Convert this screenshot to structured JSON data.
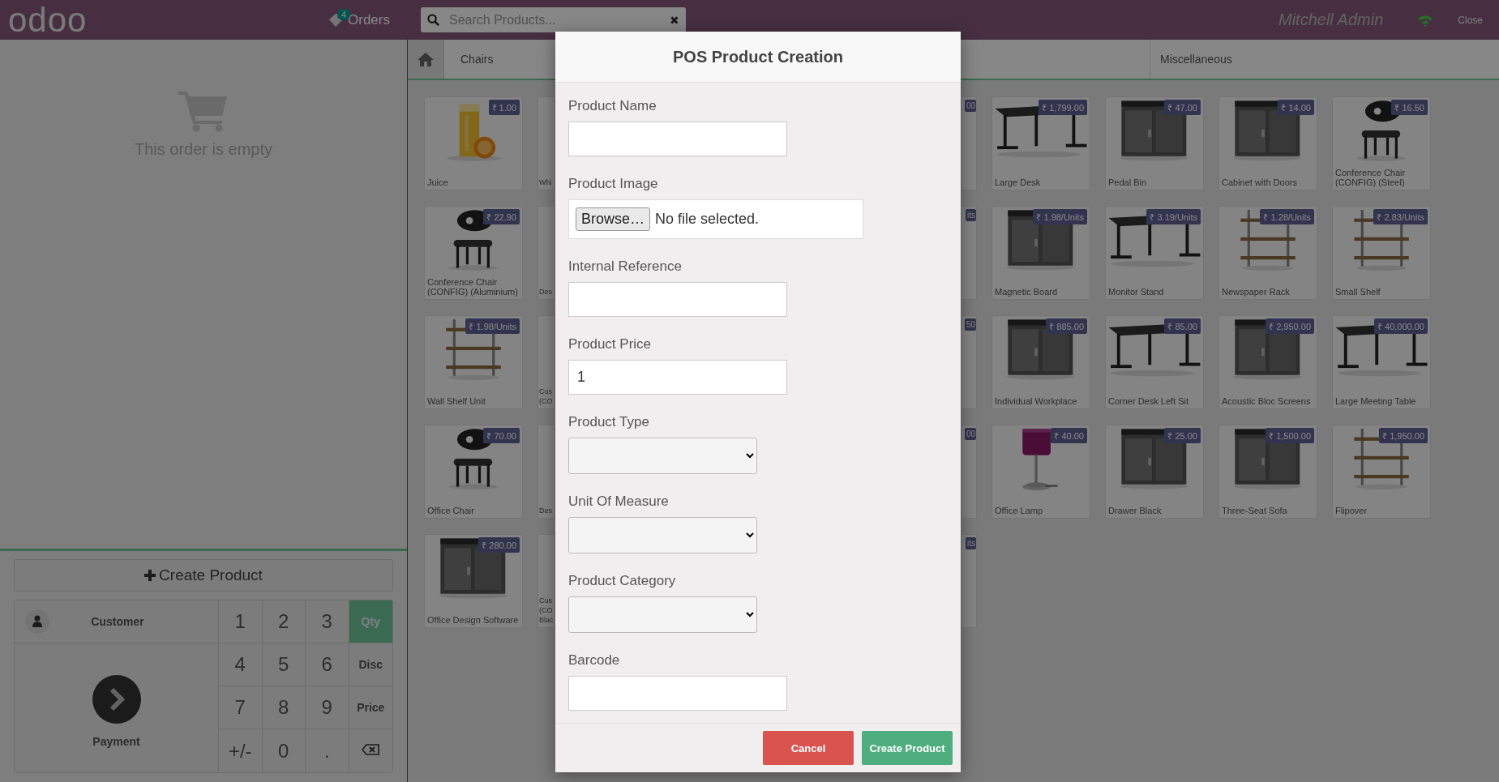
{
  "header": {
    "logo": "odoo",
    "orders": {
      "label": "Orders",
      "count": "4"
    },
    "search": {
      "placeholder": "Search Products...",
      "clear": "✖"
    },
    "user": "Mitchell Admin",
    "close": "Close"
  },
  "order": {
    "empty_text": "This order is empty"
  },
  "create_button": {
    "label": "Create Product"
  },
  "actionpad": {
    "customer": "Customer",
    "payment": "Payment"
  },
  "numpad": {
    "keys": [
      "1",
      "2",
      "3",
      "4",
      "5",
      "6",
      "7",
      "8",
      "9",
      "+/-",
      "0",
      "."
    ],
    "modes": [
      {
        "label": "Qty",
        "selected": true
      },
      {
        "label": "Disc",
        "selected": false
      },
      {
        "label": "Price",
        "selected": false
      }
    ]
  },
  "categories": [
    "Chairs",
    "Miscellaneous"
  ],
  "product_rows": [
    {
      "left": [
        {
          "kind": "full",
          "name": "Juice",
          "price": "₹ 1.00"
        },
        {
          "kind": "cut",
          "name": "Whi"
        }
      ],
      "right": [
        {
          "kind": "cut",
          "price": "00"
        },
        {
          "kind": "full",
          "name": "Large Desk",
          "price": "₹ 1,799.00"
        },
        {
          "kind": "full",
          "name": "Pedal Bin",
          "price": "₹ 47.00"
        },
        {
          "kind": "full",
          "name": "Cabinet with Doors",
          "price": "₹ 14.00"
        },
        {
          "kind": "full",
          "name": "Conference Chair (CONFIG) (Steel)",
          "price": "₹ 16.50"
        }
      ]
    },
    {
      "left": [
        {
          "kind": "full",
          "name": "Conference Chair (CONFIG) (Aluminium)",
          "price": "₹ 22.90"
        },
        {
          "kind": "cut",
          "name": "Des"
        }
      ],
      "right": [
        {
          "kind": "cut",
          "price": "its"
        },
        {
          "kind": "full",
          "name": "Magnetic Board",
          "price": "₹ 1.98/Units"
        },
        {
          "kind": "full",
          "name": "Monitor Stand",
          "price": "₹ 3.19/Units"
        },
        {
          "kind": "full",
          "name": "Newspaper Rack",
          "price": "₹ 1.28/Units"
        },
        {
          "kind": "full",
          "name": "Small Shelf",
          "price": "₹ 2.83/Units"
        }
      ]
    },
    {
      "left": [
        {
          "kind": "full",
          "name": "Wall Shelf Unit",
          "price": "₹ 1.98/Units"
        },
        {
          "kind": "cut",
          "name": "Cus (CO"
        }
      ],
      "right": [
        {
          "kind": "cut",
          "price": "50"
        },
        {
          "kind": "full",
          "name": "Individual Workplace",
          "price": "₹ 885.00"
        },
        {
          "kind": "full",
          "name": "Corner Desk Left Sit",
          "price": "₹ 85.00"
        },
        {
          "kind": "full",
          "name": "Acoustic Bloc Screens",
          "price": "₹ 2,950.00"
        },
        {
          "kind": "full",
          "name": "Large Meeting Table",
          "price": "₹ 40,000.00"
        }
      ]
    },
    {
      "left": [
        {
          "kind": "full",
          "name": "Office Chair",
          "price": "₹ 70.00"
        },
        {
          "kind": "cut",
          "name": "Des"
        }
      ],
      "right": [
        {
          "kind": "cut",
          "price": "00"
        },
        {
          "kind": "full",
          "name": "Office Lamp",
          "price": "₹ 40.00"
        },
        {
          "kind": "full",
          "name": "Drawer Black",
          "price": "₹ 25.00"
        },
        {
          "kind": "full",
          "name": "Three-Seat Sofa",
          "price": "₹ 1,500.00"
        },
        {
          "kind": "full",
          "name": "Flipover",
          "price": "₹ 1,950.00"
        }
      ]
    },
    {
      "left": [
        {
          "kind": "full",
          "name": "Office Design Software",
          "price": "₹ 280.00"
        },
        {
          "kind": "cut",
          "name": "Cus (CO Blac"
        }
      ],
      "right": [
        {
          "kind": "cut",
          "price": "its"
        }
      ]
    }
  ],
  "modal": {
    "title": "POS Product Creation",
    "fields": [
      {
        "kind": "text",
        "label": "Product Name"
      },
      {
        "kind": "file",
        "label": "Product Image",
        "button": "Browse…",
        "status": "No file selected."
      },
      {
        "kind": "text",
        "label": "Internal Reference"
      },
      {
        "kind": "text",
        "label": "Product Price",
        "value": "1"
      },
      {
        "kind": "select",
        "label": "Product Type"
      },
      {
        "kind": "select",
        "label": "Unit Of Measure"
      },
      {
        "kind": "select",
        "label": "Product Category"
      },
      {
        "kind": "text",
        "label": "Barcode"
      }
    ],
    "buttons": [
      {
        "kind": "cancel",
        "label": "Cancel"
      },
      {
        "kind": "confirm",
        "label": "Create Product"
      }
    ]
  }
}
